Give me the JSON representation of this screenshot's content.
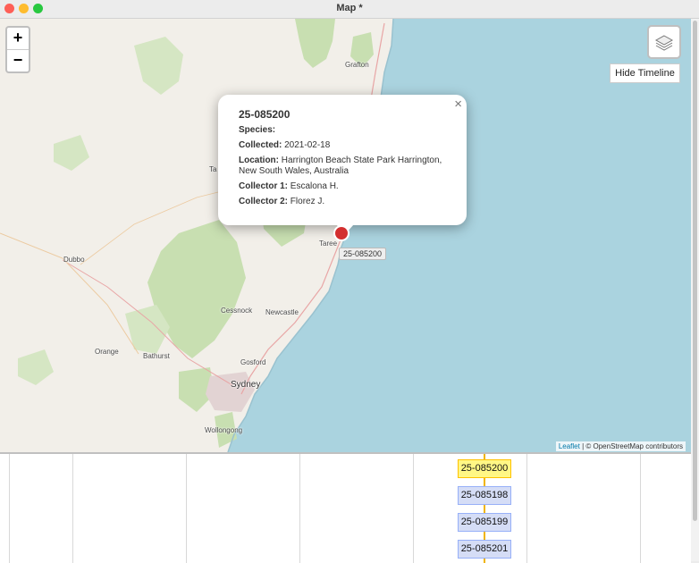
{
  "window": {
    "title": "Map *"
  },
  "map": {
    "zoom_in": "+",
    "zoom_out": "−",
    "hide_timeline": "Hide Timeline",
    "places": [
      "Grafton",
      "Taree",
      "Dubbo",
      "Cessnock",
      "Newcastle",
      "Orange",
      "Bathurst",
      "Gosford",
      "Sydney",
      "Wollongong",
      "Ta"
    ],
    "attribution": {
      "leaflet": "Leaflet",
      "rest": " | © OpenStreetMap contributors"
    }
  },
  "popup": {
    "close": "×",
    "id": "25-085200",
    "species_label": "Species:",
    "collected_label": "Collected:",
    "collected_value": "2021-02-18",
    "location_label": "Location:",
    "location_value": "Harrington Beach State Park Harrington, New South Wales, Australia",
    "collector1_label": "Collector 1:",
    "collector1_value": "Escalona H.",
    "collector2_label": "Collector 2:",
    "collector2_value": "Florez J."
  },
  "marker_label": "25-085200",
  "timeline": {
    "items": [
      "25-085200",
      "25-085198",
      "25-085199",
      "25-085201"
    ]
  }
}
